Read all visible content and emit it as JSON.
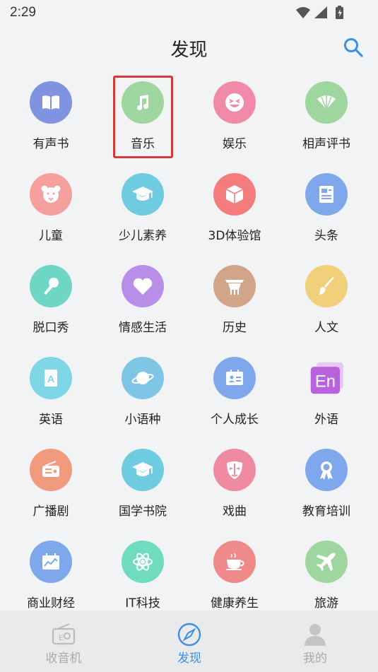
{
  "status_bar": {
    "time": "2:29"
  },
  "header": {
    "title": "发现"
  },
  "categories": [
    {
      "label": "有声书",
      "icon": "book-icon",
      "color": "#7f93e0"
    },
    {
      "label": "音乐",
      "icon": "music-note-icon",
      "color": "#9fd6a0"
    },
    {
      "label": "娱乐",
      "icon": "laughing-face-icon",
      "color": "#f08aa8"
    },
    {
      "label": "相声评书",
      "icon": "folding-fan-icon",
      "color": "#9fd6a0"
    },
    {
      "label": "儿童",
      "icon": "bear-face-icon",
      "color": "#f5a09c"
    },
    {
      "label": "少儿素养",
      "icon": "graduation-cap-icon",
      "color": "#6fcbe0"
    },
    {
      "label": "3D体验馆",
      "icon": "cube-icon",
      "color": "#f47c7c"
    },
    {
      "label": "头条",
      "icon": "newspaper-icon",
      "color": "#7fa8ec"
    },
    {
      "label": "脱口秀",
      "icon": "microphone-icon",
      "color": "#6fd6c6"
    },
    {
      "label": "情感生活",
      "icon": "heart-icon",
      "color": "#b98ee8"
    },
    {
      "label": "历史",
      "icon": "ancient-vessel-icon",
      "color": "#d1a58a"
    },
    {
      "label": "人文",
      "icon": "paintbrush-icon",
      "color": "#f0d07a"
    },
    {
      "label": "英语",
      "icon": "letter-a-card-icon",
      "color": "#7fd6e6"
    },
    {
      "label": "小语种",
      "icon": "planet-icon",
      "color": "#7fc6e6"
    },
    {
      "label": "个人成长",
      "icon": "id-card-icon",
      "color": "#7fa8ec"
    },
    {
      "label": "外语",
      "icon": "en-badge-icon",
      "color": "#c07ae0"
    },
    {
      "label": "广播剧",
      "icon": "radio-icon",
      "color": "#f29a7e"
    },
    {
      "label": "国学书院",
      "icon": "graduation-cap-icon",
      "color": "#6fcbe0"
    },
    {
      "label": "戏曲",
      "icon": "opera-mask-icon",
      "color": "#f08aa0"
    },
    {
      "label": "教育培训",
      "icon": "award-ribbon-icon",
      "color": "#7fa8ec"
    },
    {
      "label": "商业财经",
      "icon": "calendar-chart-icon",
      "color": "#7fa8ec"
    },
    {
      "label": "IT科技",
      "icon": "atom-icon",
      "color": "#6fdcc0"
    },
    {
      "label": "健康养生",
      "icon": "teacup-icon",
      "color": "#f08a8a"
    },
    {
      "label": "旅游",
      "icon": "airplane-icon",
      "color": "#9fd6a0"
    }
  ],
  "nav": [
    {
      "label": "收音机",
      "icon": "radio-icon",
      "active": false
    },
    {
      "label": "发现",
      "icon": "compass-icon",
      "active": true
    },
    {
      "label": "我的",
      "icon": "user-icon",
      "active": false
    }
  ],
  "colors": {
    "accent": "#3d8ee8",
    "highlight_border": "#d43a3a"
  }
}
